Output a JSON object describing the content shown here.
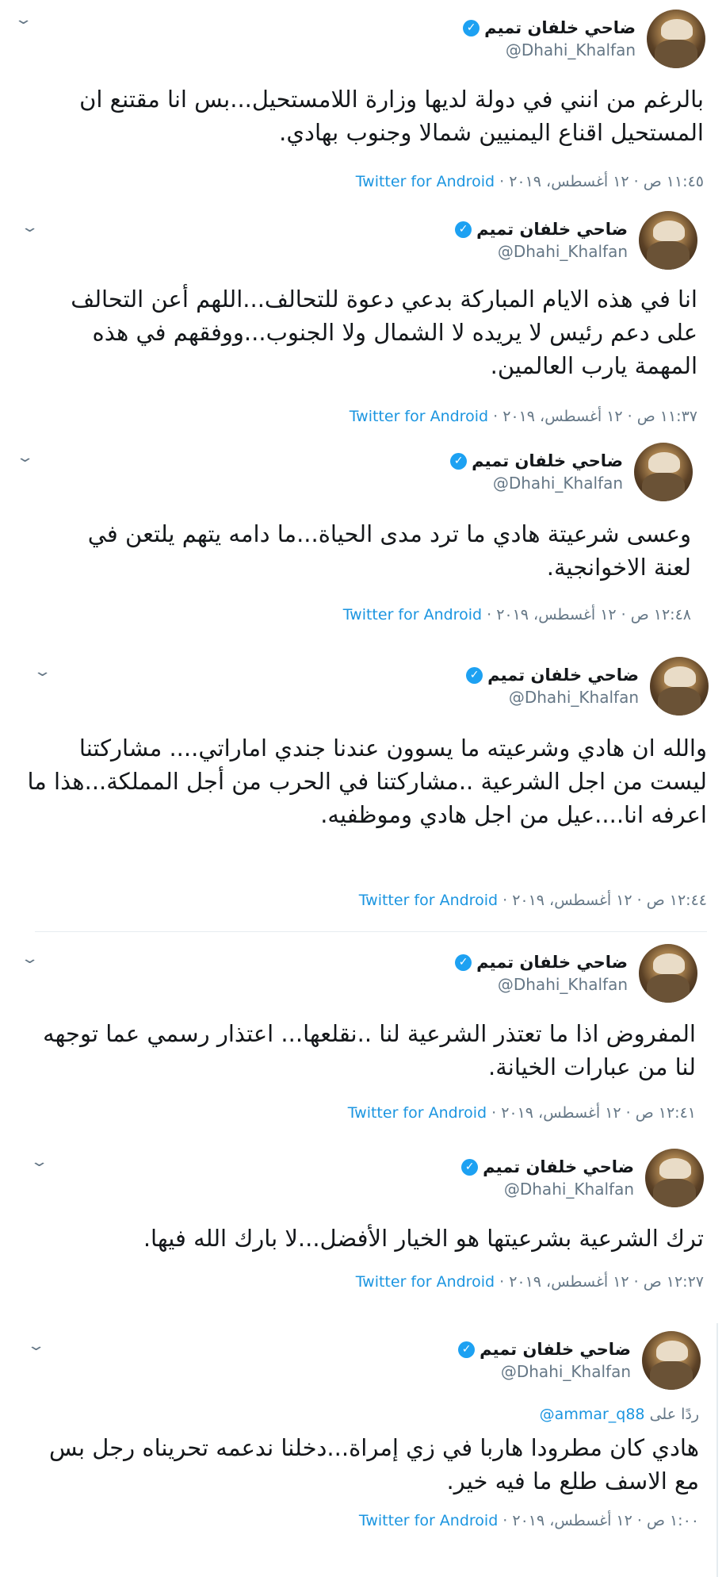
{
  "author": {
    "display_name": "ضاحي خلفان تميم",
    "handle": "@Dhahi_Khalfan",
    "verified_glyph": "✓",
    "avatar": "profile-photo"
  },
  "client": "Twitter for Android",
  "separator": "·",
  "chevron_glyph": "⌄",
  "colors": {
    "link": "#1b95e0",
    "verified": "#1da1f2",
    "muted": "#657786"
  },
  "tweets": [
    {
      "text": "بالرغم من انني في دولة لديها وزارة اللامستحيل...بس انا مقتنع ان المستحيل اقناع اليمنيين شمالا وجنوب بهادي.",
      "time": "١١:٤٥ ص · ١٢ أغسطس، ٢٠١٩"
    },
    {
      "text": "انا في هذه الايام المباركة بدعي دعوة للتحالف...اللهم أعن التحالف على دعم رئيس لا يريده لا الشمال ولا الجنوب...ووفقهم في هذه المهمة يارب العالمين.",
      "time": "١١:٣٧ ص · ١٢ أغسطس، ٢٠١٩"
    },
    {
      "text": "وعسى شرعيتة هادي ما ترد مدى الحياة...ما دامه يتهم يلتعن في لعنة الاخوانجية.",
      "time": "١٢:٤٨ ص · ١٢ أغسطس، ٢٠١٩"
    },
    {
      "text": "والله ان هادي وشرعيته ما يسوون عندنا جندي اماراتي.... مشاركتنا ليست من اجل الشرعية ..مشاركتنا في الحرب من أجل المملكة...هذا ما اعرفه انا....عيل من اجل هادي وموظفيه.",
      "time": "١٢:٤٤ ص · ١٢ أغسطس، ٢٠١٩"
    },
    {
      "text": "المفروض اذا ما تعتذر الشرعية لنا ..نقلعها... اعتذار رسمي عما توجهه لنا من عبارات الخيانة.",
      "time": "١٢:٤١ ص · ١٢ أغسطس، ٢٠١٩"
    },
    {
      "text": "ترك الشرعية بشرعيتها هو الخيار الأفضل...لا بارك الله فيها.",
      "time": "١٢:٢٧ ص · ١٢ أغسطس، ٢٠١٩"
    },
    {
      "reply_prefix": "ردًا على",
      "reply_to": "@ammar_q88",
      "text": "هادي كان مطرودا هاربا في زي إمراة...دخلنا ندعمه تحريناه رجل بس مع الاسف طلع ما فيه خير.",
      "time": "١:٠٠ ص · ١٢ أغسطس، ٢٠١٩"
    }
  ]
}
